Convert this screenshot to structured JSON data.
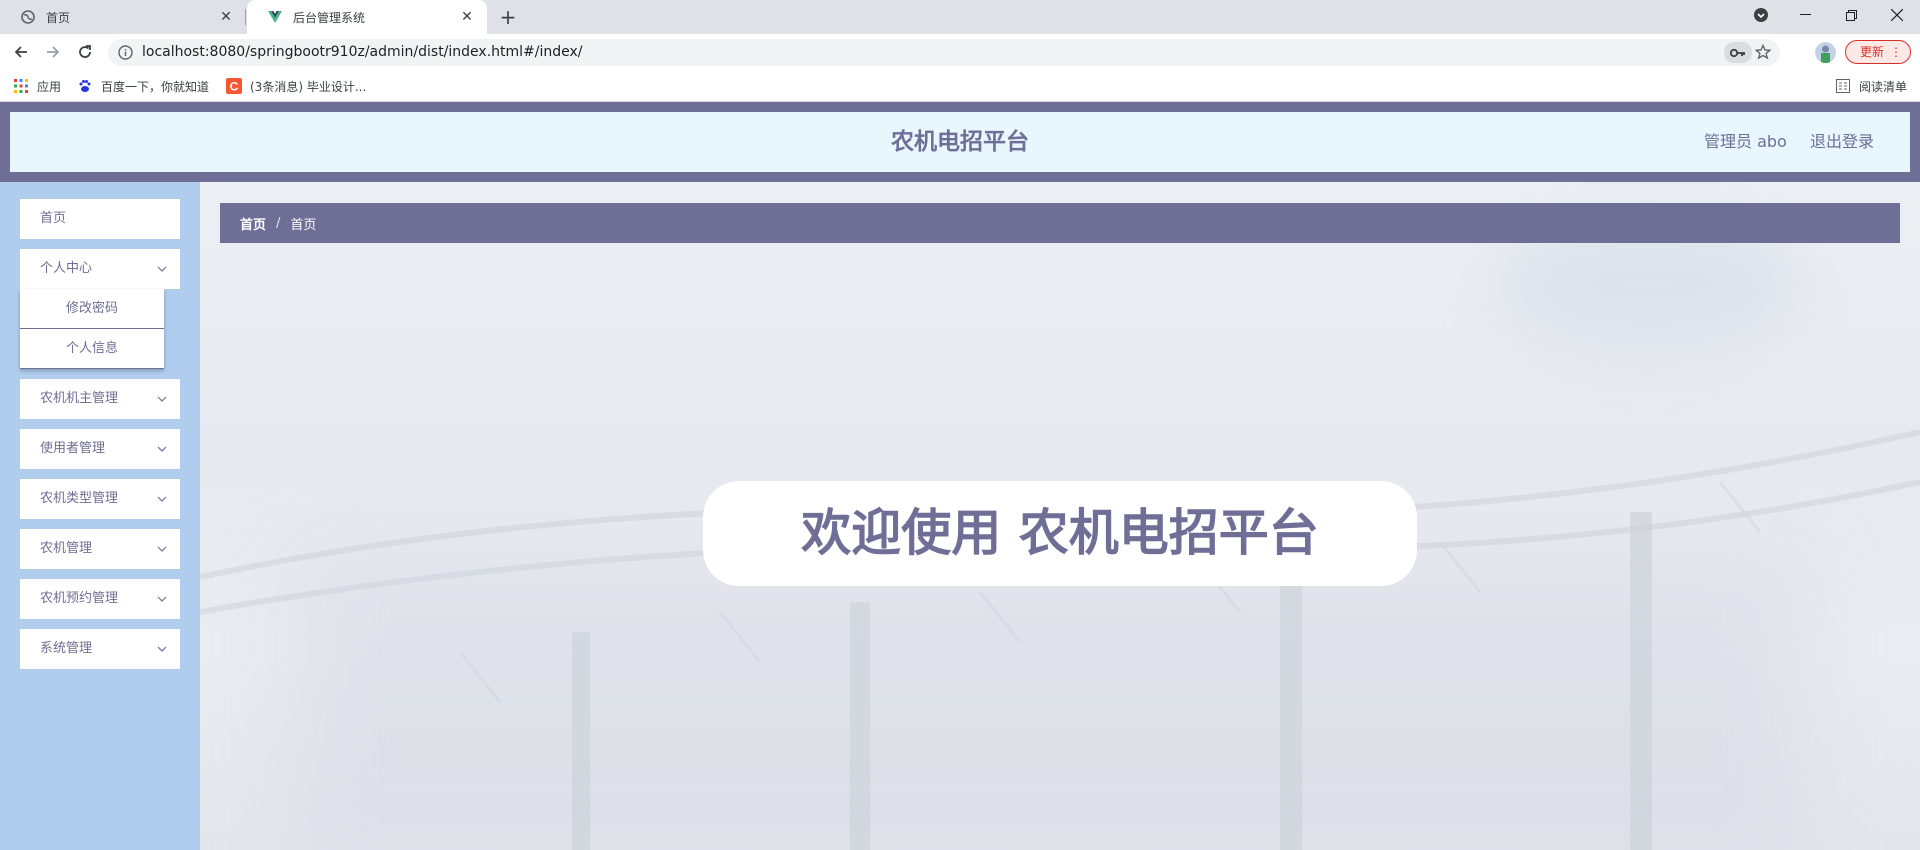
{
  "browser": {
    "tabs": [
      {
        "title": "首页",
        "active": false,
        "icon": "globe-icon"
      },
      {
        "title": "后台管理系统",
        "active": true,
        "icon": "vue-icon"
      }
    ],
    "url": "localhost:8080/springbootr910z/admin/dist/index.html#/index/",
    "update_label": "更新",
    "bookmarks": [
      {
        "label": "应用",
        "icon": "apps-grid-icon"
      },
      {
        "label": "百度一下，你就知道",
        "icon": "baidu-paw-icon"
      },
      {
        "label": "(3条消息) 毕业设计...",
        "icon": "csdn-c-icon"
      }
    ],
    "reading_list": "阅读清单"
  },
  "header": {
    "title": "农机电招平台",
    "user": "管理员 abo",
    "logout": "退出登录"
  },
  "sidebar": {
    "items": [
      {
        "label": "首页",
        "expandable": false
      },
      {
        "label": "个人中心",
        "expandable": true,
        "expanded": true,
        "children": [
          "修改密码",
          "个人信息"
        ]
      },
      {
        "label": "农机机主管理",
        "expandable": true
      },
      {
        "label": "使用者管理",
        "expandable": true
      },
      {
        "label": "农机类型管理",
        "expandable": true
      },
      {
        "label": "农机管理",
        "expandable": true
      },
      {
        "label": "农机预约管理",
        "expandable": true
      },
      {
        "label": "系统管理",
        "expandable": true
      }
    ]
  },
  "breadcrumb": {
    "home": "首页",
    "separator": "/",
    "current": "首页"
  },
  "welcome": {
    "text": "欢迎使用 农机电招平台"
  },
  "colors": {
    "theme": "#6e6e96",
    "sidebar_bg": "#b1cdee",
    "header_inner_bg": "#e8f6fe",
    "update_red": "#d93025"
  }
}
